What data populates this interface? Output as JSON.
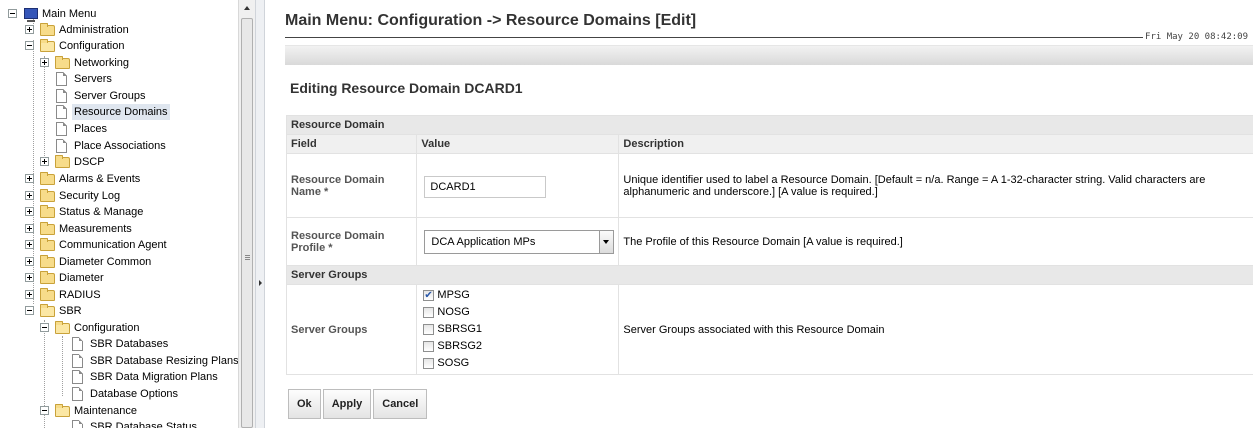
{
  "tree": {
    "items": [
      {
        "label": "Main Menu"
      },
      {
        "label": "Administration"
      },
      {
        "label": "Configuration"
      },
      {
        "label": "Networking"
      },
      {
        "label": "Servers"
      },
      {
        "label": "Server Groups"
      },
      {
        "label": "Resource Domains",
        "selected": true
      },
      {
        "label": "Places"
      },
      {
        "label": "Place Associations"
      },
      {
        "label": "DSCP"
      },
      {
        "label": "Alarms & Events"
      },
      {
        "label": "Security Log"
      },
      {
        "label": "Status & Manage"
      },
      {
        "label": "Measurements"
      },
      {
        "label": "Communication Agent"
      },
      {
        "label": "Diameter Common"
      },
      {
        "label": "Diameter"
      },
      {
        "label": "RADIUS"
      },
      {
        "label": "SBR"
      },
      {
        "label": "Configuration"
      },
      {
        "label": "SBR Databases"
      },
      {
        "label": "SBR Database Resizing Plans"
      },
      {
        "label": "SBR Data Migration Plans"
      },
      {
        "label": "Database Options"
      },
      {
        "label": "Maintenance"
      },
      {
        "label": "SBR Database Status"
      }
    ]
  },
  "header": {
    "title": "Main Menu: Configuration -> Resource Domains [Edit]",
    "timestamp": "Fri May 20 08:42:09"
  },
  "form": {
    "heading": "Editing Resource Domain DCARD1",
    "section1": "Resource Domain",
    "col_field": "Field",
    "col_value": "Value",
    "col_description": "Description",
    "name_field": "Resource Domain Name *",
    "name_value": "DCARD1",
    "name_description": "Unique identifier used to label a Resource Domain. [Default = n/a. Range = A 1-32-character string. Valid characters are alphanumeric and underscore.] [A value is required.]",
    "profile_field": "Resource Domain Profile *",
    "profile_value": "DCA Application MPs",
    "profile_description": "The Profile of this Resource Domain [A value is required.]",
    "section2": "Server Groups",
    "groups_field": "Server Groups",
    "groups": [
      {
        "label": "MPSG",
        "checked": true
      },
      {
        "label": "NOSG",
        "checked": false
      },
      {
        "label": "SBRSG1",
        "checked": false
      },
      {
        "label": "SBRSG2",
        "checked": false
      },
      {
        "label": "SOSG",
        "checked": false
      }
    ],
    "groups_description": "Server Groups associated with this Resource Domain"
  },
  "buttons": {
    "ok": "Ok",
    "apply": "Apply",
    "cancel": "Cancel"
  }
}
